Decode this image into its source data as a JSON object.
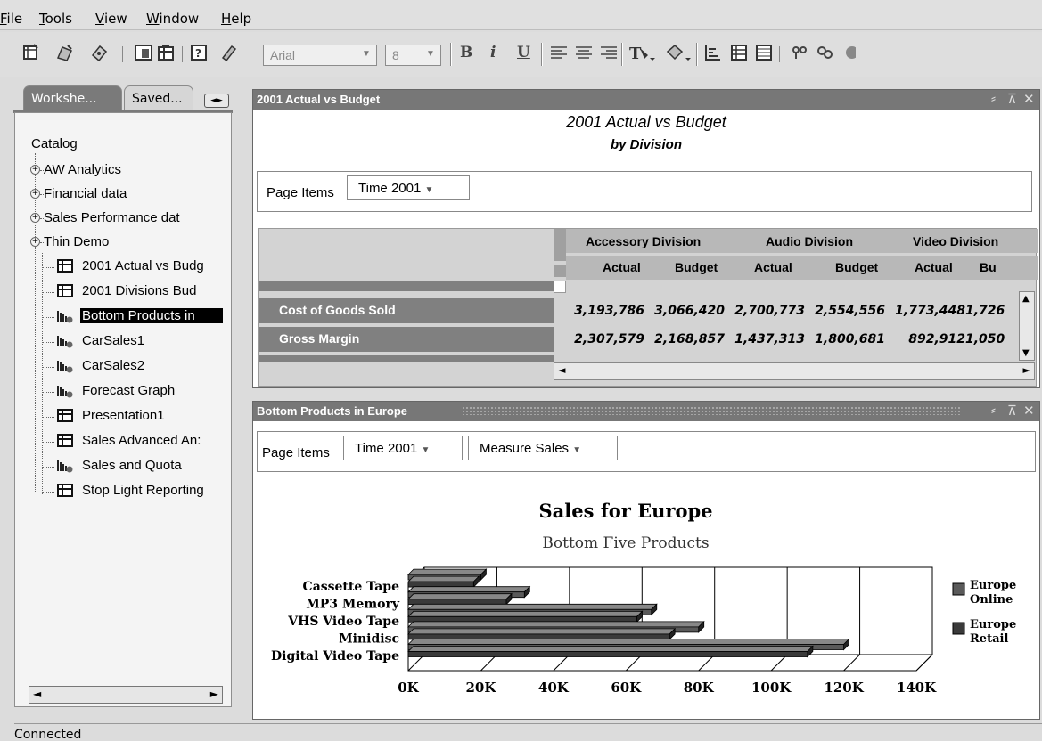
{
  "menu": [
    "File",
    "Tools",
    "View",
    "Window",
    "Help"
  ],
  "toolbar": {
    "font_name": "Arial",
    "font_size": "8",
    "bold": "B",
    "italic": "i",
    "underline": "U"
  },
  "left_panel": {
    "tabs": [
      "Workshe...",
      "Saved..."
    ],
    "catalog_label": "Catalog",
    "folders": [
      "AW Analytics",
      "Financial data",
      "Sales Performance dat",
      "Thin Demo"
    ],
    "items": [
      {
        "label": "2001 Actual vs Budg",
        "icon": "worksheet-icon"
      },
      {
        "label": "2001 Divisions Bud",
        "icon": "worksheet-icon"
      },
      {
        "label": "Bottom Products in",
        "icon": "graph-icon",
        "selected": true
      },
      {
        "label": "CarSales1",
        "icon": "graph-icon"
      },
      {
        "label": "CarSales2",
        "icon": "graph-icon"
      },
      {
        "label": "Forecast Graph",
        "icon": "graph-icon"
      },
      {
        "label": "Presentation1",
        "icon": "worksheet-icon"
      },
      {
        "label": "Sales Advanced An:",
        "icon": "worksheet-icon"
      },
      {
        "label": "Sales and Quota",
        "icon": "graph-icon"
      },
      {
        "label": "Stop Light Reporting",
        "icon": "worksheet-icon"
      }
    ]
  },
  "top_panel": {
    "window_title": "2001 Actual vs Budget",
    "title": "2001 Actual vs Budget",
    "subtitle": "by Division",
    "page_items_label": "Page Items",
    "page_item": "Time  2001",
    "divisions": [
      "Accessory Division",
      "Audio Division",
      "Video Division"
    ],
    "measures": [
      "Actual",
      "Budget",
      "Actual",
      "Budget",
      "Actual",
      "Bu"
    ],
    "rows": [
      {
        "label": "Cost of Goods Sold",
        "values": [
          "3,193,786",
          "3,066,420",
          "2,700,773",
          "2,554,556",
          "1,773,448",
          "1,726"
        ]
      },
      {
        "label": "Gross Margin",
        "values": [
          "2,307,579",
          "2,168,857",
          "1,437,313",
          "1,800,681",
          "892,912",
          "1,050"
        ]
      }
    ]
  },
  "bottom_panel": {
    "window_title": "Bottom Products in Europe",
    "page_items_label": "Page Items",
    "page_items": [
      "Time  2001",
      "Measure  Sales"
    ]
  },
  "chart_data": {
    "type": "bar",
    "orientation": "horizontal",
    "title": "Sales for Europe",
    "subtitle": "Bottom Five Products",
    "categories": [
      "Cassette Tape",
      "MP3 Memory",
      "VHS Video Tape",
      "Minidisc",
      "Digital Video Tape"
    ],
    "series": [
      {
        "name": "Europe Online",
        "values": [
          20000,
          32000,
          67000,
          80000,
          120000
        ]
      },
      {
        "name": "Europe Retail",
        "values": [
          18000,
          27000,
          63000,
          72000,
          110000
        ]
      }
    ],
    "x_ticks": [
      "0K",
      "20K",
      "40K",
      "60K",
      "80K",
      "100K",
      "120K",
      "140K"
    ],
    "xlim": [
      0,
      140000
    ],
    "grid": true,
    "legend": "right",
    "legend_labels": [
      [
        "Europe",
        "Online"
      ],
      [
        "Europe",
        "Retail"
      ]
    ]
  },
  "status": "Connected"
}
